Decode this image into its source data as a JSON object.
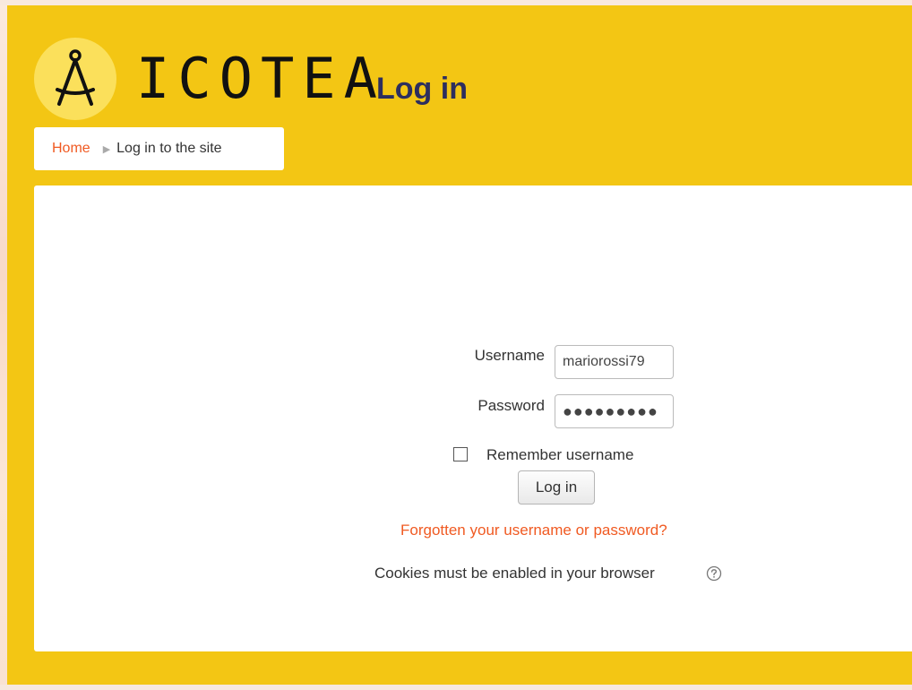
{
  "brand": {
    "name": "ICOTEA",
    "logo_icon": "compass-icon"
  },
  "breadcrumb": {
    "home": "Home",
    "separator": "▶",
    "current": "Log in to the site"
  },
  "login": {
    "title": "Log in",
    "username_label": "Username",
    "username_value": "mariorossi79",
    "password_label": "Password",
    "password_value": "●●●●●●●●●",
    "remember_label": "Remember username",
    "remember_checked": false,
    "submit_label": "Log in",
    "forgot_link": "Forgotten your username or password?",
    "cookies_notice": "Cookies must be enabled in your browser",
    "help_icon": "question-circle-icon"
  },
  "colors": {
    "background": "#f3c614",
    "logo_circle": "#fbe05b",
    "link": "#f05a22",
    "title": "#2d2e5e"
  }
}
